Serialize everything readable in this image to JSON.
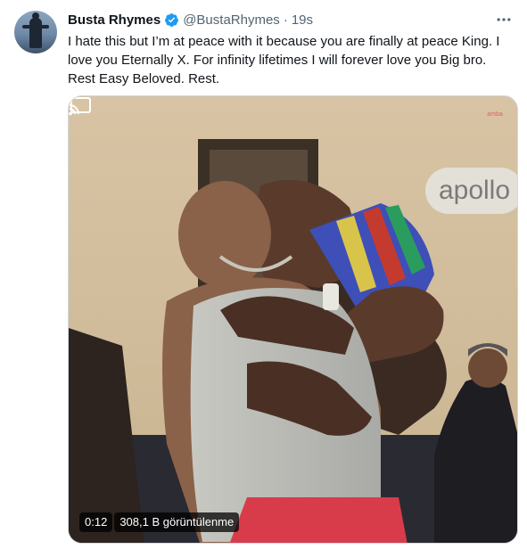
{
  "author": {
    "name": "Busta Rhymes",
    "handle": "@BustaRhymes",
    "separator": "·",
    "time": "19s"
  },
  "tweet": {
    "text": "I hate this but I’m at peace with it because you are finally at peace King. I love you Eternally X. For infinity lifetimes I will forever love you Big bro. Rest Easy Beloved. Rest."
  },
  "media": {
    "sign_text": "apollo",
    "watermark": "amba",
    "elapsed": "0:12",
    "views": "308,1 B görüntülenme"
  },
  "icons": {
    "verified": "verified-badge-icon",
    "more": "more-options-icon",
    "cast": "cast-icon"
  },
  "colors": {
    "verified_blue": "#1d9bf0",
    "secondary_text": "#536471"
  }
}
